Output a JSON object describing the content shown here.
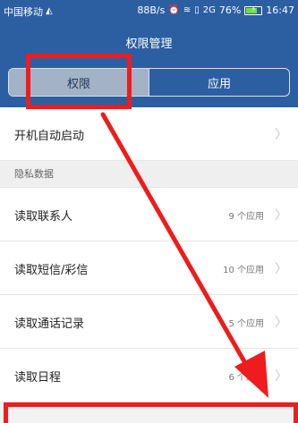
{
  "status": {
    "carrier": "中国移动",
    "speed": "88B/s",
    "network": "2G",
    "battery": "76%",
    "battery_level": 0.76,
    "time": "16:47"
  },
  "header": {
    "title": "权限管理",
    "tabs": [
      {
        "label": "权限",
        "active": true
      },
      {
        "label": "应用",
        "active": false
      }
    ]
  },
  "list": {
    "autostart": {
      "label": "开机自动启动"
    },
    "section_privacy": "隐私数据",
    "items": [
      {
        "label": "读取联系人",
        "count": "9 个应用"
      },
      {
        "label": "读取短信/彩信",
        "count": "10 个应用"
      },
      {
        "label": "读取通话记录",
        "count": "5 个应用"
      },
      {
        "label": "读取日程",
        "count": "6 个应用"
      }
    ]
  },
  "colors": {
    "header_bg": "#2c5ea2",
    "tab_active_bg": "#a3b2c6",
    "annotation": "#ee1c1c"
  },
  "icons": [
    "signal-icon",
    "alarm-icon",
    "wifi-icon",
    "sim-icon",
    "battery-icon",
    "chevron-right-icon"
  ]
}
